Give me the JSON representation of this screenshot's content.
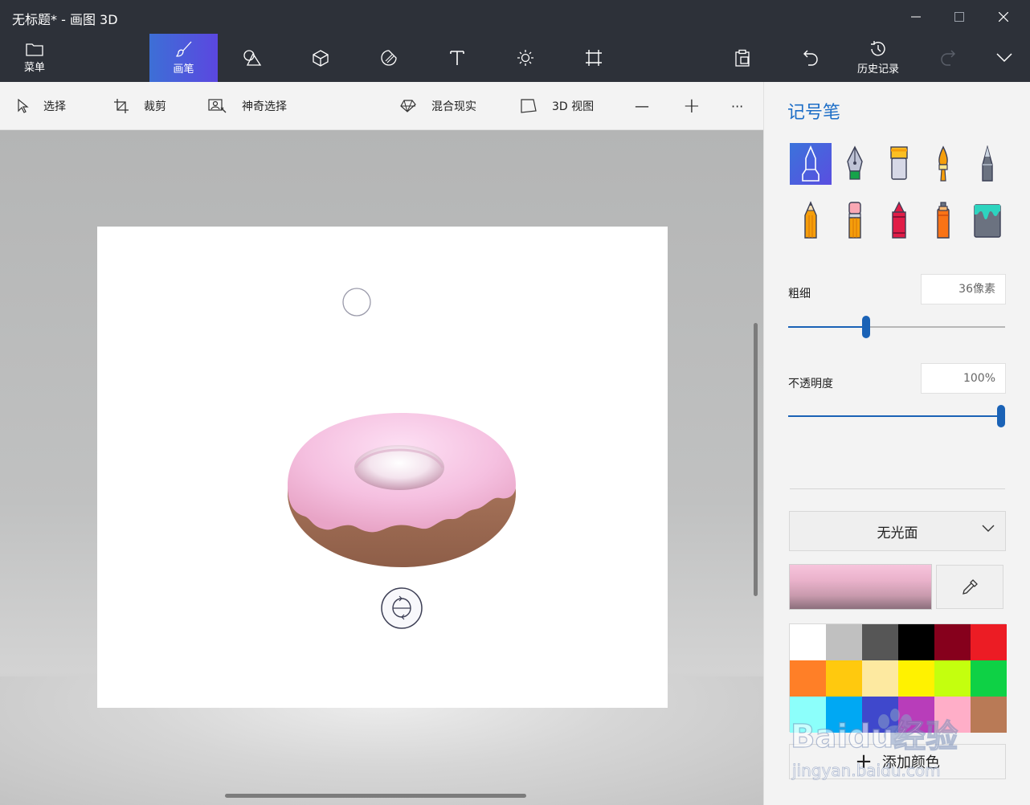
{
  "window": {
    "title": "无标题* - 画图 3D",
    "minimize": "—",
    "maximize": "☐",
    "close": "✕"
  },
  "toolbar": {
    "menu_label": "菜单",
    "brushes_label": "画笔",
    "history_label": "历史记录",
    "tools": [
      {
        "name": "2d-shapes",
        "icon": "shapes-icon"
      },
      {
        "name": "3d-shapes",
        "icon": "cube-icon"
      },
      {
        "name": "stickers",
        "icon": "sticker-icon"
      },
      {
        "name": "text",
        "icon": "text-icon"
      },
      {
        "name": "effects",
        "icon": "sun-icon"
      },
      {
        "name": "canvas",
        "icon": "canvas-icon"
      },
      {
        "name": "paste",
        "icon": "paste-icon"
      },
      {
        "name": "undo",
        "icon": "undo-icon"
      },
      {
        "name": "redo",
        "icon": "redo-icon"
      },
      {
        "name": "expand",
        "icon": "chevron-down-icon"
      }
    ]
  },
  "subbar": {
    "select": "选择",
    "crop": "裁剪",
    "magic_select": "神奇选择",
    "mixed_reality": "混合现实",
    "view_3d": "3D 视图",
    "zoom_out": "—",
    "zoom_in": "+",
    "more": "···"
  },
  "panel": {
    "title": "记号笔",
    "brushes": [
      {
        "name": "marker",
        "icon": "marker-icon",
        "selected": true
      },
      {
        "name": "calligraphy-pen",
        "icon": "calligraphy-pen-icon"
      },
      {
        "name": "oil-brush",
        "icon": "oil-brush-icon"
      },
      {
        "name": "watercolor",
        "icon": "watercolor-icon"
      },
      {
        "name": "pixel-pen",
        "icon": "pixel-pen-icon"
      },
      {
        "name": "pencil",
        "icon": "pencil-icon"
      },
      {
        "name": "eraser",
        "icon": "eraser-icon"
      },
      {
        "name": "crayon",
        "icon": "crayon-icon"
      },
      {
        "name": "spray-can",
        "icon": "spray-can-icon"
      },
      {
        "name": "fill",
        "icon": "fill-bucket-icon"
      }
    ],
    "thickness_label": "粗细",
    "thickness_value": "36像素",
    "thickness_fraction": 0.36,
    "opacity_label": "不透明度",
    "opacity_value": "100%",
    "opacity_fraction": 1.0,
    "finish": "无光面",
    "current_color": "#f2b8d4",
    "palette": [
      "#ffffff",
      "#c0c0c0",
      "#565656",
      "#000000",
      "#86001c",
      "#ec1c24",
      "#ff7f27",
      "#ffc90e",
      "#fde9a0",
      "#fff200",
      "#c4ff0e",
      "#0ed145",
      "#8cfffb",
      "#00a8f3",
      "#3f48cc",
      "#b83dba",
      "#ffaec8",
      "#b97a56"
    ],
    "add_color": "添加颜色"
  },
  "watermark": {
    "brand": "Baidu经验",
    "url": "jingyan.baidu.com"
  }
}
